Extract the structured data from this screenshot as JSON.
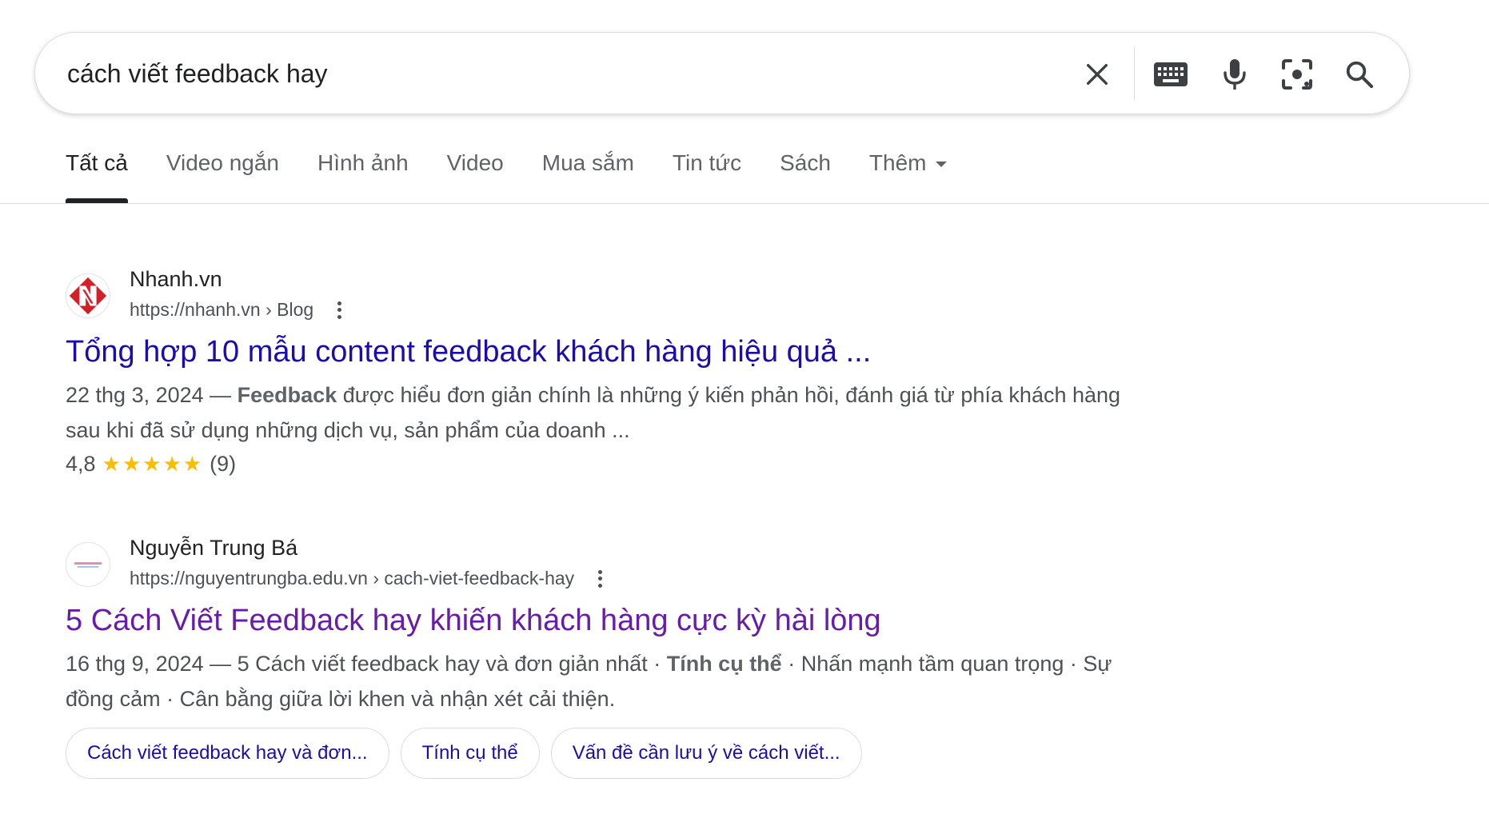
{
  "search": {
    "query": "cách viết feedback hay"
  },
  "tabs": [
    {
      "label": "Tất cả",
      "active": true
    },
    {
      "label": "Video ngắn"
    },
    {
      "label": "Hình ảnh"
    },
    {
      "label": "Video"
    },
    {
      "label": "Mua sắm"
    },
    {
      "label": "Tin tức"
    },
    {
      "label": "Sách"
    },
    {
      "label": "Thêm"
    }
  ],
  "results": [
    {
      "site_name": "Nhanh.vn",
      "url": "https://nhanh.vn › Blog",
      "title": "Tổng hợp 10 mẫu content feedback khách hàng hiệu quả ...",
      "date": "22 thg 3, 2024 — ",
      "snippet_bold": "Feedback",
      "snippet_rest": " được hiểu đơn giản chính là những ý kiến phản hồi, đánh giá từ phía khách hàng sau khi đã sử dụng những dịch vụ, sản phẩm của doanh ...",
      "rating": "4,8",
      "stars": "★★★★★",
      "rating_count": "(9)"
    },
    {
      "site_name": "Nguyễn Trung Bá",
      "url": "https://nguyentrungba.edu.vn › cach-viet-feedback-hay",
      "title": "5 Cách Viết Feedback hay khiến khách hàng cực kỳ hài lòng",
      "date": "16 thg 9, 2024 — ",
      "snippet_a": "5 Cách viết feedback hay và đơn giản nhất · ",
      "snippet_bold": "Tính cụ thể",
      "snippet_b": " · Nhấn mạnh tầm quan trọng · Sự đồng cảm · Cân bằng giữa lời khen và nhận xét cải thiện.",
      "chips": [
        "Cách viết feedback hay và đơn...",
        "Tính cụ thể",
        "Vấn đề cần lưu ý về cách viết..."
      ]
    }
  ],
  "colors": {
    "link": "#1a0dab",
    "visited": "#681da8",
    "star": "#fbbc04",
    "nhanh_red": "#d32027"
  },
  "icons": [
    "close-icon",
    "keyboard-icon",
    "microphone-icon",
    "lens-camera-icon",
    "search-icon",
    "more-vert-icon"
  ]
}
